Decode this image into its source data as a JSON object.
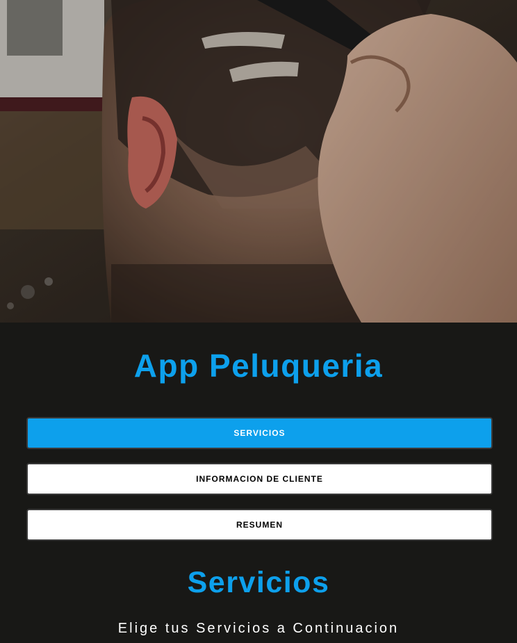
{
  "hero": {
    "image_alt": "barber-haircut-photo"
  },
  "app": {
    "title": "App Peluqueria",
    "accent_color": "#0da0ec",
    "background_color": "#181816"
  },
  "nav": {
    "items": [
      {
        "label": "SERVICIOS",
        "active": true
      },
      {
        "label": "INFORMACION DE CLIENTE",
        "active": false
      },
      {
        "label": "RESUMEN",
        "active": false
      }
    ]
  },
  "section": {
    "title": "Servicios",
    "description": "Elige tus Servicios a Continuacion"
  }
}
